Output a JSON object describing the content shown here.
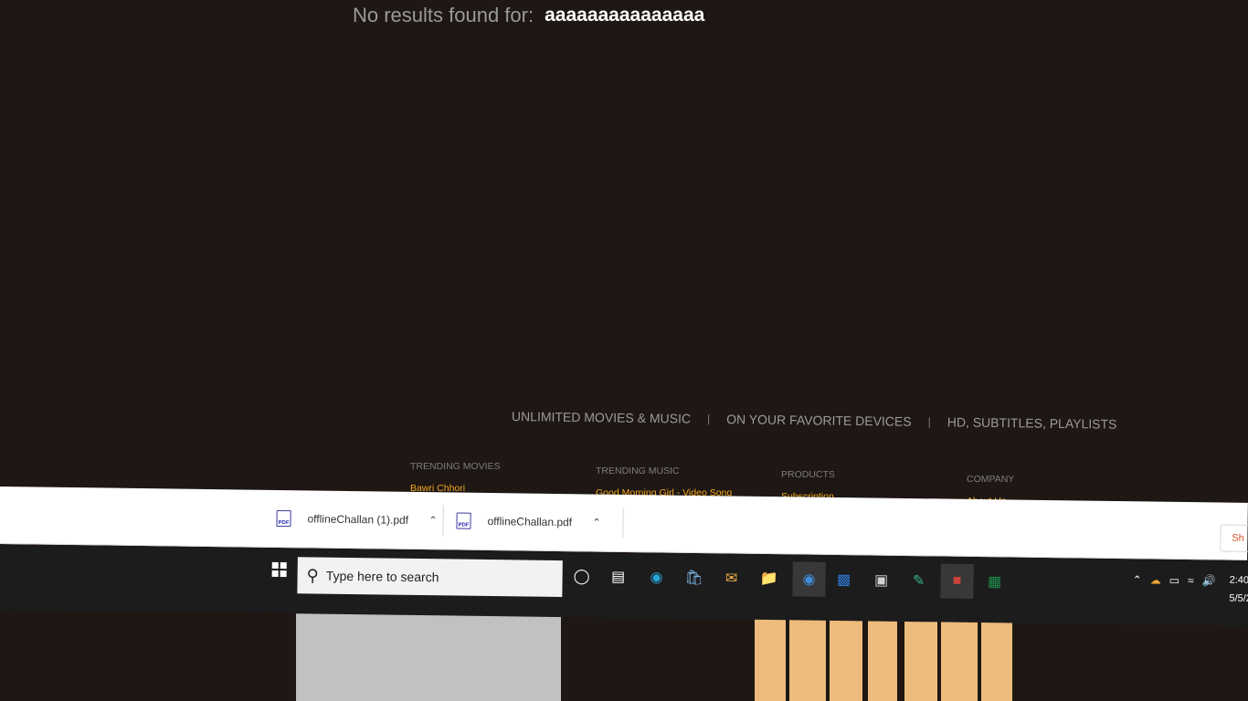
{
  "search_result": {
    "label": "No results found for:",
    "query": "aaaaaaaaaaaaaaa"
  },
  "features": [
    "UNLIMITED MOVIES & MUSIC",
    "|",
    "ON YOUR FAVORITE DEVICES",
    "|",
    "HD, SUBTITLES, PLAYLISTS"
  ],
  "footer": [
    {
      "heading": "TRENDING MOVIES",
      "link": "Bawri Chhori"
    },
    {
      "heading": "TRENDING MUSIC",
      "link": "Good Morning Girl - Video Song"
    },
    {
      "heading": "PRODUCTS",
      "link": "Subscription"
    },
    {
      "heading": "COMPANY",
      "link": "About Us"
    }
  ],
  "downloads": {
    "items": [
      {
        "file": "offlineChallan (1).pdf",
        "icon": "pdf-file-icon"
      },
      {
        "file": "offlineChallan.pdf",
        "icon": "pdf-file-icon"
      }
    ],
    "show_all": "Sh"
  },
  "taskbar": {
    "search_placeholder": "Type here to search",
    "apps": [
      "cortana-icon",
      "task-view-icon",
      "edge-icon",
      "store-icon",
      "mail-icon",
      "file-explorer-icon",
      "chrome-icon",
      "outlook-icon",
      "terminal-icon",
      "notepad-icon",
      "teams-icon",
      "excel-icon"
    ],
    "tray": [
      "chevron-up-icon",
      "onedrive-icon",
      "battery-icon",
      "wifi-icon",
      "volume-icon"
    ],
    "time": "2:40",
    "date": "5/5/2"
  },
  "colors": {
    "page_bg": "#1e1714",
    "accent": "#f3a81e",
    "taskbar_bg": "#1c1c1c"
  }
}
